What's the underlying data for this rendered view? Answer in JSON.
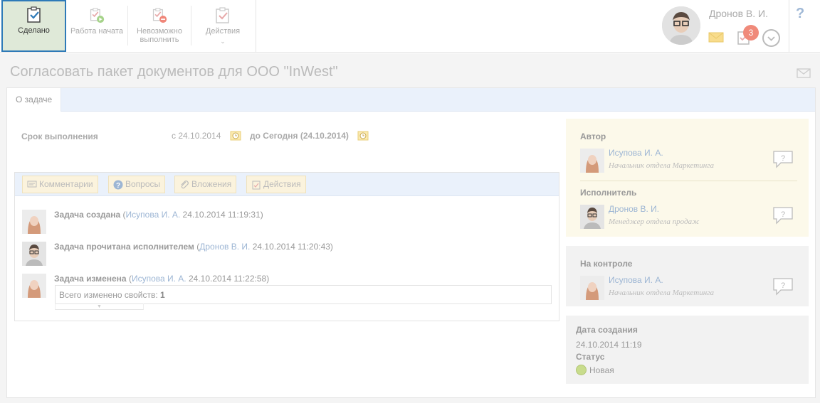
{
  "toolbar": {
    "done_label": "Сделано",
    "start_label": "Работа начата",
    "impossible_label_1": "Невозможно",
    "impossible_label_2": "выполнить",
    "actions_label": "Действия"
  },
  "user": {
    "name": "Дронов В. И.",
    "tasks_badge": "3"
  },
  "help_label": "?",
  "task": {
    "title": "Согласовать пакет документов для ООО \"InWest\""
  },
  "tabs": {
    "about": "О задаче"
  },
  "due": {
    "label": "Срок выполнения",
    "from": "с 24.10.2014",
    "to": "до Сегодня (24.10.2014)"
  },
  "feed_tabs": {
    "comments": "Комментарии",
    "questions": "Вопросы",
    "attachments": "Вложения",
    "actions": "Действия"
  },
  "events": [
    {
      "title": "Задача создана",
      "open": " (",
      "author": "Исупова И. А.",
      "time": " 24.10.2014 11:19:31)"
    },
    {
      "title": "Задача прочитана исполнителем",
      "open": " (",
      "author": "Дронов В. И.",
      "time": " 24.10.2014 11:20:43)"
    },
    {
      "title": "Задача изменена",
      "open": " (",
      "author": "Исупова И. А.",
      "time": " 24.10.2014 11:22:58)"
    }
  ],
  "changes": {
    "label": "Всего изменено свойств: ",
    "count": "1"
  },
  "author_panel": {
    "heading": "Автор",
    "name": "Исупова И. А.",
    "position": "Начальник отдела Маркетинга"
  },
  "executor_panel": {
    "heading": "Исполнитель",
    "name": "Дронов В. И.",
    "position": "Менеджер отдела продаж"
  },
  "control_panel": {
    "heading": "На контроле",
    "name": "Исупова И. А.",
    "position": "Начальник отдела Маркетинга"
  },
  "info": {
    "created_label": "Дата создания",
    "created_value": "24.10.2014 11:19",
    "status_label": "Статус",
    "status_value": "Новая"
  },
  "colors": {
    "accent_border": "#2e7ab8",
    "done_bg": "#dfe9d8",
    "link": "#9db6d4",
    "badge": "#f08a7a",
    "yellow_panel": "#fcf9ea"
  }
}
